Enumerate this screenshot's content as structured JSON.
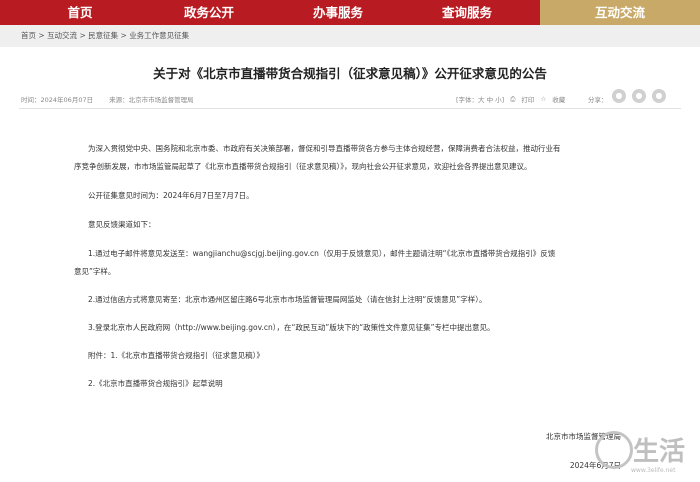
{
  "nav": {
    "items": [
      "首页",
      "政务公开",
      "办事服务",
      "查询服务"
    ],
    "active_item": "互动交流"
  },
  "breadcrumb": [
    "首页",
    "互动交流",
    "民意征集",
    "业务工作意见征集"
  ],
  "article": {
    "title": "关于对《北京市直播带货合规指引（征求意见稿）》公开征求意见的公告",
    "date": "时间：2024年06月07日",
    "source": "来源：北京市市场监督管理局",
    "font_size_label": "[字体：大 中 小]",
    "print_label": "打印",
    "favorite_label": "收藏",
    "share_label": "分享：",
    "paragraphs": [
      "为深入贯彻党中央、国务院和北京市委、市政府有关决策部署，督促和引导直播带货各方参与主体合规经营，保障消费者合法权益，推动行业有",
      "序竞争创新发展，市市场监管局起草了《北京市直播带货合规指引（征求意见稿）》，现向社会公开征求意见，欢迎社会各界提出意见建议。",
      "公开征集意见时间为：2024年6月7日至7月7日。",
      "意见反馈渠道如下：",
      "1.通过电子邮件将意见发送至：wangjianchu@scjgj.beijing.gov.cn（仅用于反馈意见），邮件主题请注明“《北京市直播带货合规指引》反馈",
      "意见”字样。",
      "2.通过信函方式将意见寄至：北京市通州区留庄路6号北京市市场监督管理局网监处（请在信封上注明“反馈意见”字样）。",
      "3.登录北京市人民政府网（http://www.beijing.gov.cn），在“政民互动”版块下的“政策性文件意见征集”专栏中提出意见。",
      "附件：1.《北京市直播带货合规指引（征求意见稿）》",
      "2.《北京市直播带货合规指引》起草说明"
    ],
    "signer": "北京市市场监督管理局",
    "sign_date": "2024年6月7日"
  },
  "watermark": {
    "text": "生活",
    "url": "www.3elife.net"
  }
}
